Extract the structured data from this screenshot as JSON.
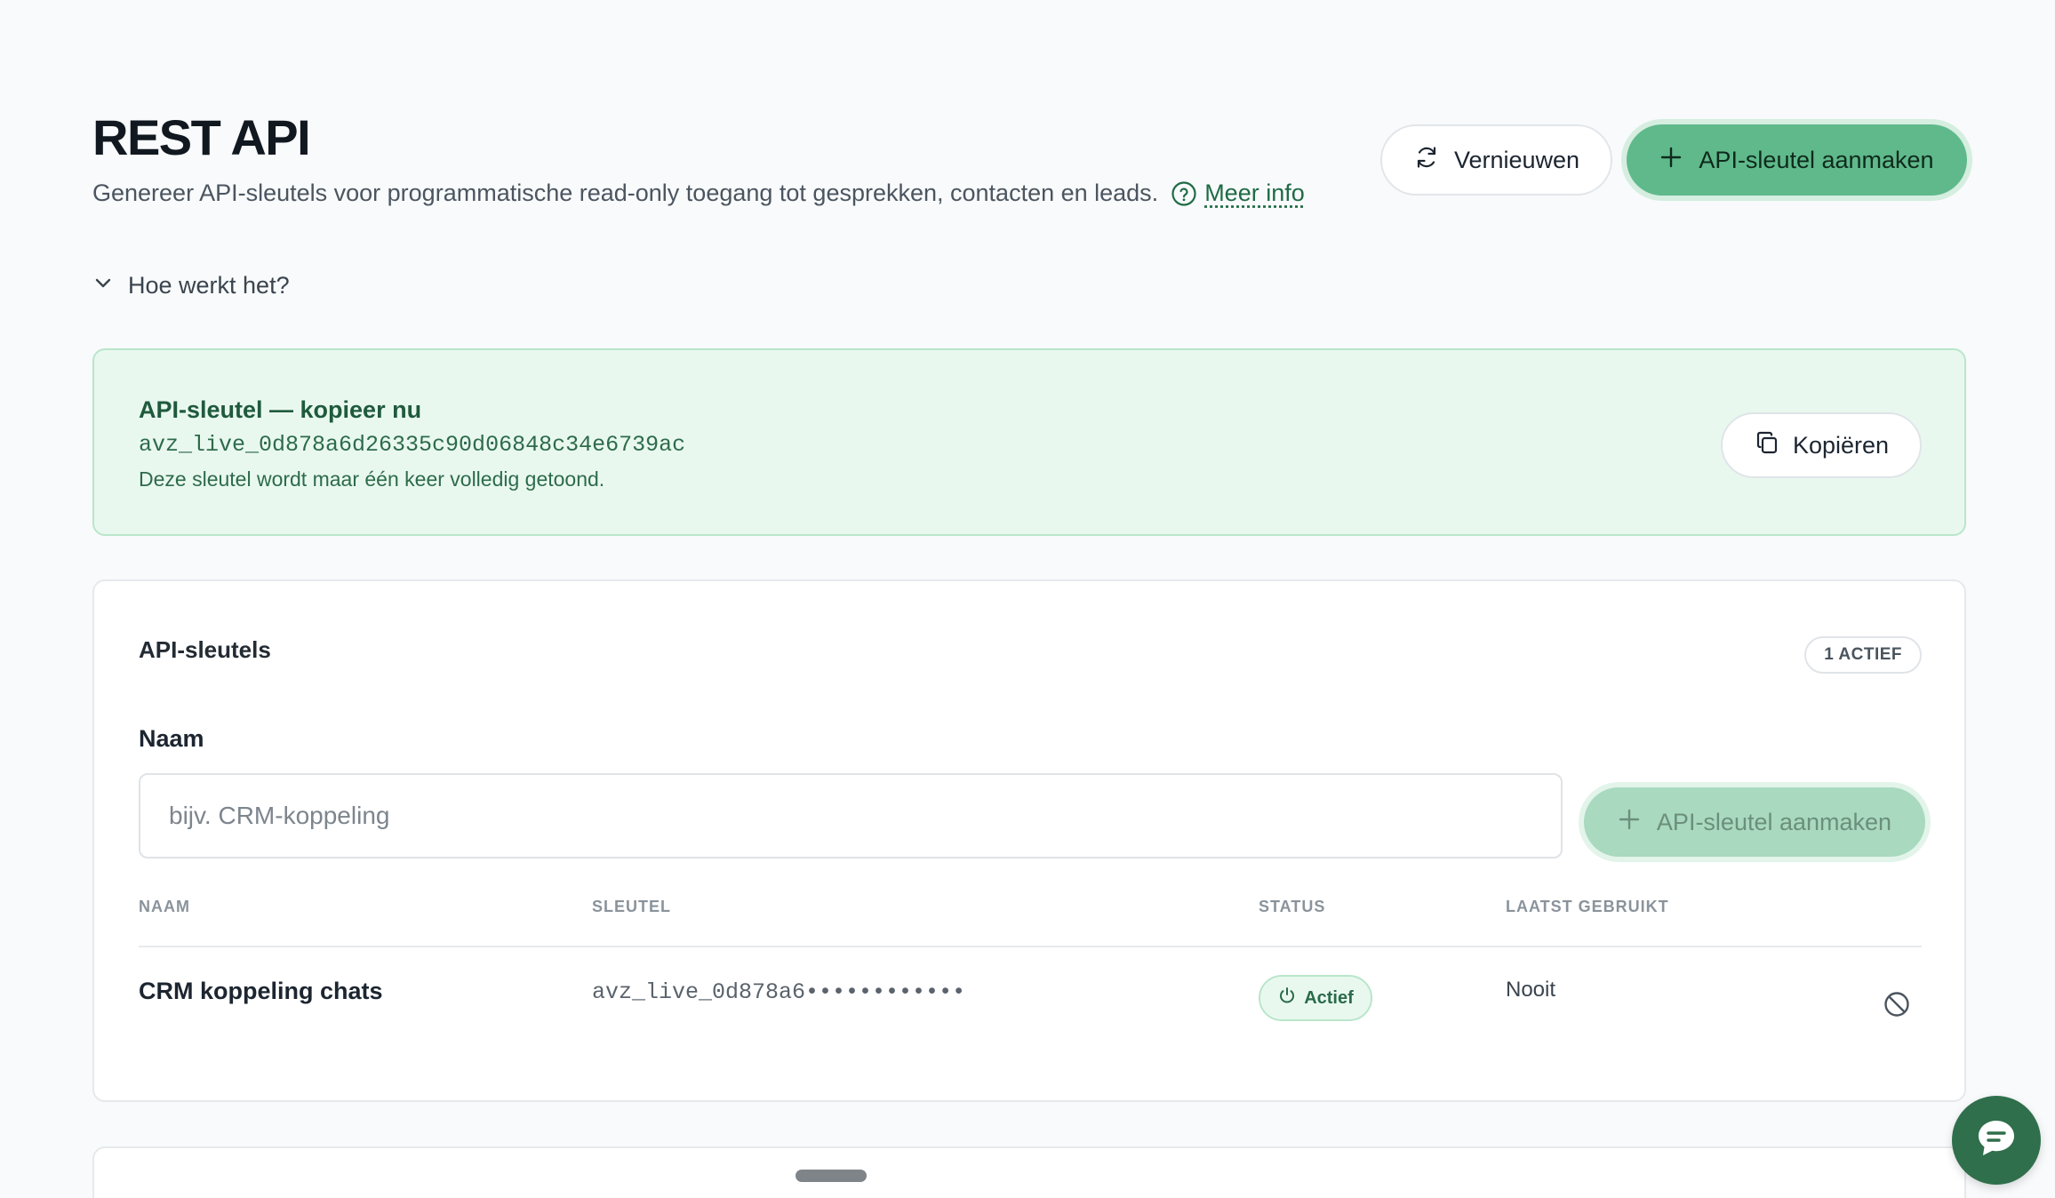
{
  "header": {
    "title": "REST API",
    "subtitle": "Genereer API-sleutels voor programmatische read-only toegang tot gesprekken, contacten en leads.",
    "more_info": "Meer info",
    "refresh_label": "Vernieuwen",
    "create_label": "API-sleutel aanmaken"
  },
  "howto": {
    "label": "Hoe werkt het?"
  },
  "key_banner": {
    "title": "API-sleutel — kopieer nu",
    "key": "avz_live_0d878a6d26335c90d06848c34e6739ac",
    "note": "Deze sleutel wordt maar één keer volledig getoond.",
    "copy_label": "Kopiëren"
  },
  "keys_card": {
    "title": "API-sleutels",
    "active_badge": "1 ACTIEF",
    "name_label": "Naam",
    "name_placeholder": "bijv. CRM-koppeling",
    "create_label": "API-sleutel aanmaken",
    "columns": [
      "NAAM",
      "SLEUTEL",
      "STATUS",
      "LAATST GEBRUIKT"
    ],
    "rows": [
      {
        "name": "CRM koppeling chats",
        "key": "avz_live_0d878a6••••••••••••",
        "status": "Actief",
        "last_used": "Nooit"
      }
    ]
  },
  "colors": {
    "accent": "#5fb98b",
    "accent_dark": "#2f6f4c",
    "banner_bg": "#e9f8ef"
  },
  "icons": {
    "refresh": "refresh-icon",
    "plus": "plus-icon",
    "help": "help-circle-icon",
    "chevron": "chevron-down-icon",
    "copy": "copy-icon",
    "power": "power-icon",
    "revoke": "ban-icon",
    "chat": "chat-icon"
  }
}
